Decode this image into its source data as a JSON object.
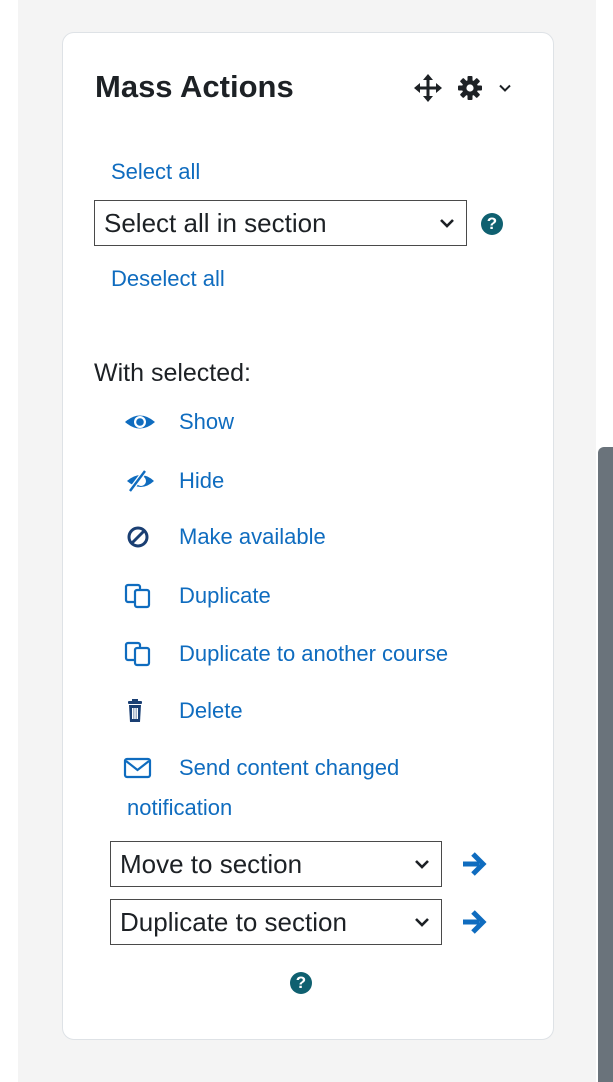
{
  "block": {
    "title": "Mass Actions",
    "move_icon": "move-icon",
    "settings_icon": "gear-icon",
    "collapse_icon": "chevron-down-icon"
  },
  "selection": {
    "select_all": "Select all",
    "section_select_value": "Select all in section",
    "deselect_all": "Deselect all"
  },
  "with_selected_label": "With selected:",
  "actions": [
    {
      "label": "Show",
      "icon": "eye-icon"
    },
    {
      "label": "Hide",
      "icon": "eye-slash-icon"
    },
    {
      "label": "Make available",
      "icon": "ban-icon"
    },
    {
      "label": "Duplicate",
      "icon": "copy-icon"
    },
    {
      "label": "Duplicate to another course",
      "icon": "copy-icon"
    },
    {
      "label": "Delete",
      "icon": "trash-icon"
    },
    {
      "label": "Send content changed",
      "label_continued": "notification",
      "icon": "envelope-icon"
    }
  ],
  "move_select": {
    "value": "Move to section",
    "go_icon": "arrow-right-icon"
  },
  "duplicate_select": {
    "value": "Duplicate to section",
    "go_icon": "arrow-right-icon"
  },
  "colors": {
    "link": "#0f6cbf",
    "text": "#1d2125",
    "help_icon": "#0f6070",
    "page_background": "#f4f4f4",
    "scrollbar_thumb": "#6a737b"
  }
}
